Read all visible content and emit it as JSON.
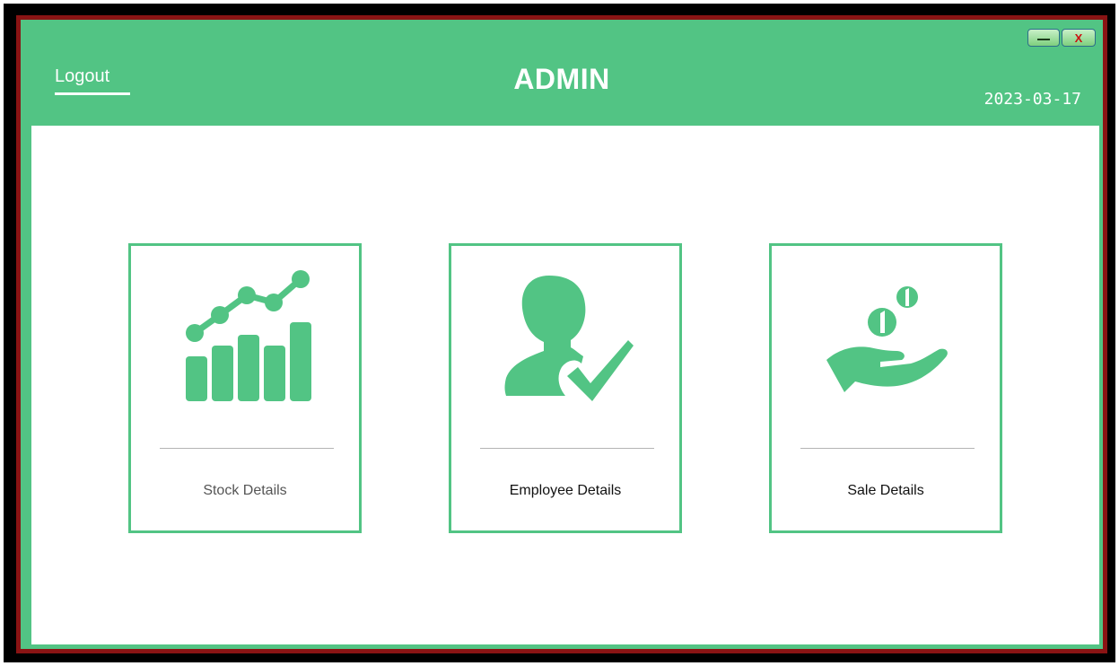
{
  "header": {
    "logout_label": "Logout",
    "title": "ADMIN",
    "date": "2023-03-17"
  },
  "window_controls": {
    "minimize_label": "—",
    "close_label": "X"
  },
  "cards": [
    {
      "label": "Stock Details",
      "icon": "chart-growth-icon"
    },
    {
      "label": "Employee Details",
      "icon": "user-check-icon"
    },
    {
      "label": "Sale Details",
      "icon": "hand-coins-icon"
    }
  ],
  "colors": {
    "accent": "#52c484",
    "background": "#ffffff",
    "frame": "#000000",
    "close_glyph": "#cc1111"
  }
}
